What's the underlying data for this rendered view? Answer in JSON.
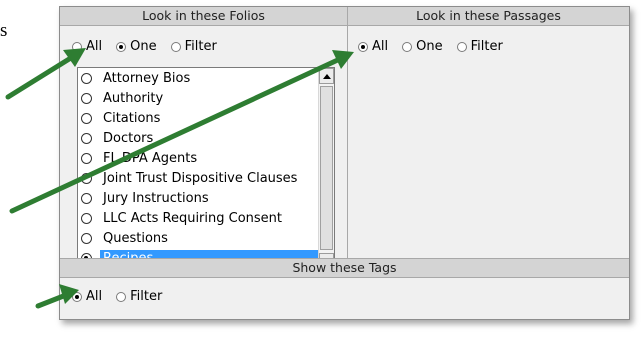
{
  "edge_text": "s",
  "folios": {
    "header": "Look in these Folios",
    "options": [
      {
        "label": "All",
        "checked": false
      },
      {
        "label": "One",
        "checked": true
      },
      {
        "label": "Filter",
        "checked": false
      }
    ],
    "list": [
      {
        "label": "Attorney Bios",
        "selected": false
      },
      {
        "label": "Authority",
        "selected": false
      },
      {
        "label": "Citations",
        "selected": false
      },
      {
        "label": "Doctors",
        "selected": false
      },
      {
        "label": "FL DPA Agents",
        "selected": false
      },
      {
        "label": "Joint Trust Dispositive Clauses",
        "selected": false
      },
      {
        "label": "Jury Instructions",
        "selected": false
      },
      {
        "label": "LLC Acts Requiring Consent",
        "selected": false
      },
      {
        "label": "Questions",
        "selected": false
      },
      {
        "label": "Recipes",
        "selected": true
      }
    ]
  },
  "passages": {
    "header": "Look in these Passages",
    "options": [
      {
        "label": "All",
        "checked": true
      },
      {
        "label": "One",
        "checked": false
      },
      {
        "label": "Filter",
        "checked": false
      }
    ]
  },
  "tags": {
    "header": "Show these Tags",
    "options": [
      {
        "label": "All",
        "checked": true
      },
      {
        "label": "Filter",
        "checked": false
      }
    ]
  },
  "colors": {
    "arrow": "#2e7d32",
    "selection": "#3399ff",
    "panel": "#f0f0f0",
    "header": "#d4d4d4"
  }
}
